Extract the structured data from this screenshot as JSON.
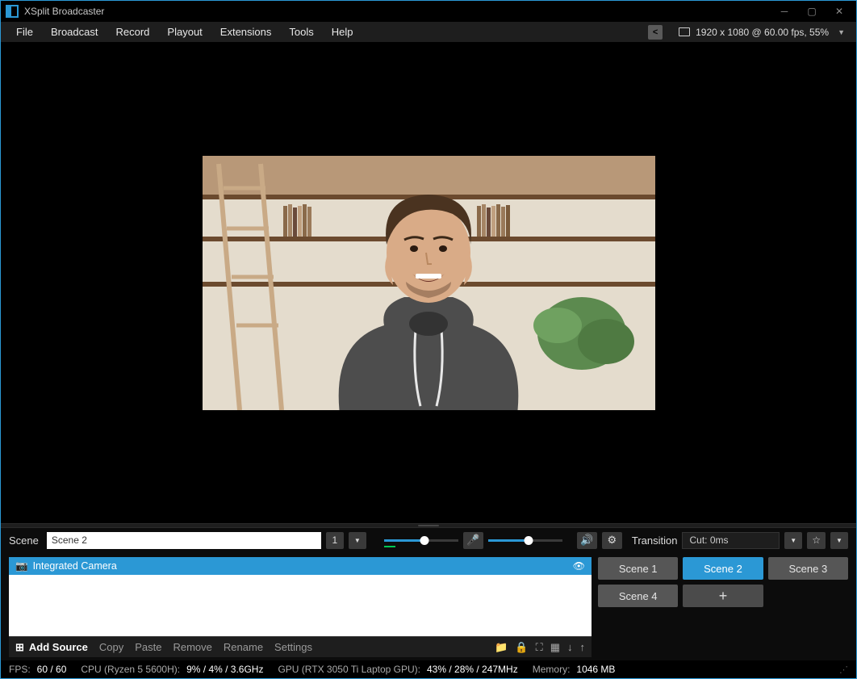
{
  "window": {
    "title": "XSplit Broadcaster"
  },
  "menubar": {
    "items": [
      "File",
      "Broadcast",
      "Record",
      "Playout",
      "Extensions",
      "Tools",
      "Help"
    ],
    "resolution": "1920 x 1080 @ 60.00 fps, 55%"
  },
  "controls": {
    "scene_label": "Scene",
    "scene_name_value": "Scene 2",
    "preview_number": "1",
    "audio_slider_pct": 55,
    "mic_slider_pct": 55,
    "transition_label": "Transition",
    "transition_value": "Cut: 0ms"
  },
  "sources": {
    "items": [
      {
        "name": "Integrated Camera",
        "visible": true
      }
    ],
    "add_label": "Add Source",
    "actions": [
      "Copy",
      "Paste",
      "Remove",
      "Rename",
      "Settings"
    ]
  },
  "scenes": {
    "buttons": [
      "Scene 1",
      "Scene 2",
      "Scene 3",
      "Scene 4"
    ],
    "active_index": 1
  },
  "status": {
    "fps_label": "FPS:",
    "fps_value": "60 / 60",
    "cpu_label": "CPU (Ryzen 5 5600H):",
    "cpu_value": "9% / 4% / 3.6GHz",
    "gpu_label": "GPU (RTX 3050 Ti Laptop GPU):",
    "gpu_value": "43% / 28% / 247MHz",
    "mem_label": "Memory:",
    "mem_value": "1046 MB"
  }
}
